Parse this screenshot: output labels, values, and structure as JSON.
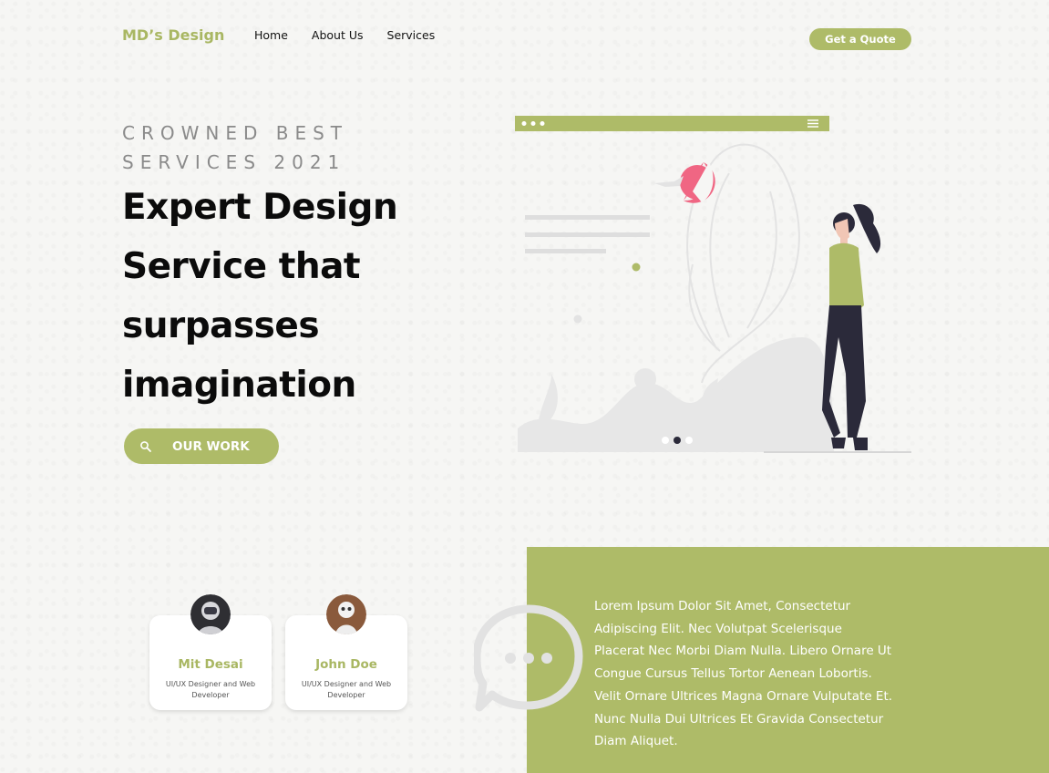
{
  "brand": {
    "logo": "MD’s Design",
    "accent_color": "#aebb68"
  },
  "nav": {
    "items": [
      {
        "label": "Home"
      },
      {
        "label": "About Us"
      },
      {
        "label": "Services"
      }
    ],
    "cta": "Get a Quote"
  },
  "hero": {
    "eyebrow_line1": "CROWNED BEST",
    "eyebrow_line2": "SERVICES 2021",
    "headline_lines": [
      "Expert Design",
      "Service that",
      "surpasses",
      "imagination"
    ],
    "button_label": "OUR WORK",
    "button_icon": "search-icon"
  },
  "illustration": {
    "carousel_dots": 3,
    "active_dot": 2
  },
  "team": [
    {
      "name": "Mit Desai",
      "role": "UI/UX Designer and Web Developer",
      "avatar": "astronaut-avatar"
    },
    {
      "name": "John Doe",
      "role": "UI/UX Designer and Web Developer",
      "avatar": "robot-avatar"
    }
  ],
  "testimonial": {
    "icon": "chat-bubble-icon",
    "text": "Lorem Ipsum Dolor Sit Amet, Consectetur Adipiscing Elit. Nec Volutpat Scelerisque Placerat Nec Morbi Diam Nulla. Libero Ornare Ut Congue Cursus Tellus Tortor Aenean Lobortis. Velit Ornare Ultrices Magna Ornare Vulputate Et. Nunc Nulla Dui Ultrices Et Gravida Consectetur Diam Aliquet."
  }
}
